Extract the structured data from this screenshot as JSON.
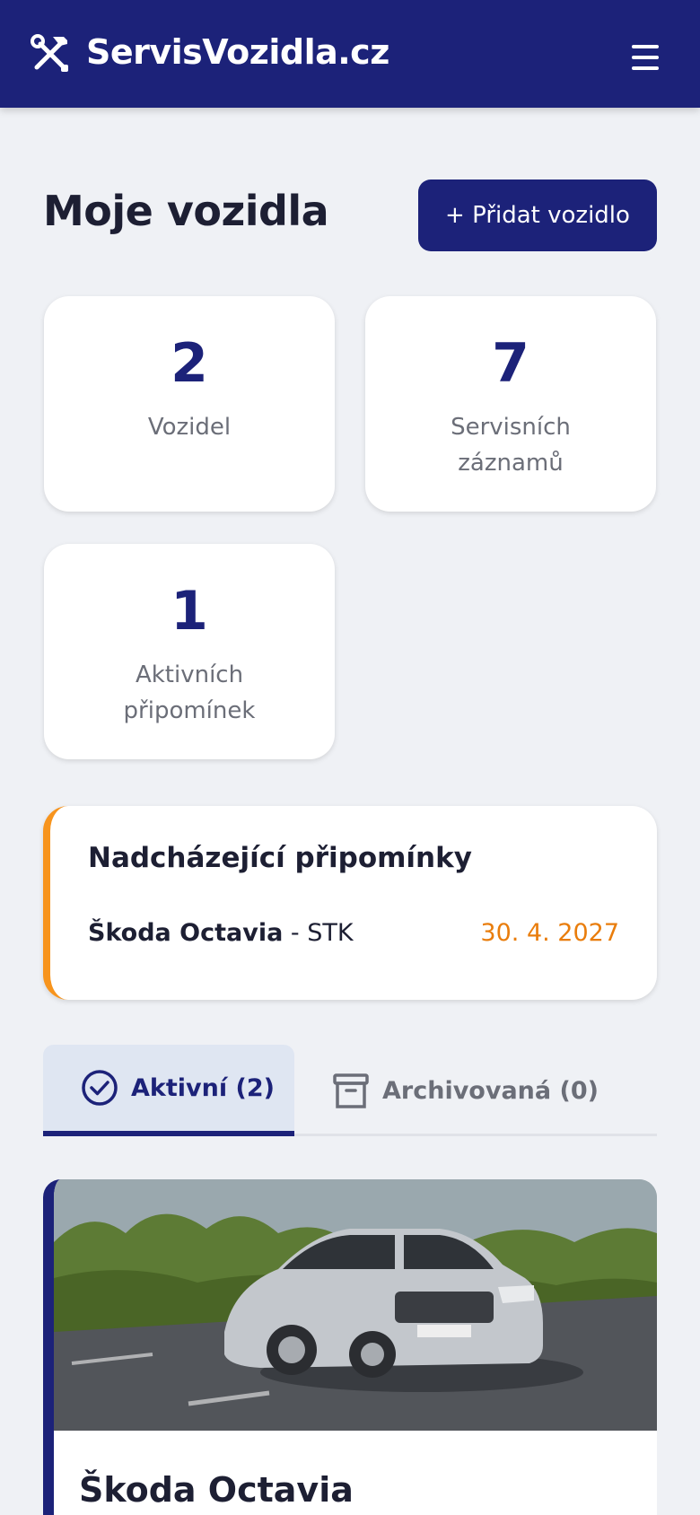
{
  "header": {
    "brand": "ServisVozidla.cz",
    "logo_icon": "tools-icon",
    "menu_icon": "hamburger-menu-icon",
    "background": "#1c2279"
  },
  "page": {
    "title": "Moje vozidla",
    "add_button_label": "+ Přidat vozidlo"
  },
  "stats": [
    {
      "value": "2",
      "label": "Vozidel"
    },
    {
      "value": "7",
      "label": "Servisních záznamů"
    },
    {
      "value": "1",
      "label": "Aktivních připomínek"
    }
  ],
  "reminders": {
    "title": "Nadcházející připomínky",
    "accent": "#f7941d",
    "items": [
      {
        "vehicle": "Škoda Octavia",
        "separator": " - ",
        "type": "STK",
        "date": "30. 4. 2027"
      }
    ]
  },
  "tabs": [
    {
      "label": "Aktivní (2)",
      "icon": "check-circle-icon",
      "active": true
    },
    {
      "label": "Archivovaná (0)",
      "icon": "archive-box-icon",
      "active": false
    }
  ],
  "vehicles": [
    {
      "name": "Škoda Octavia"
    }
  ]
}
